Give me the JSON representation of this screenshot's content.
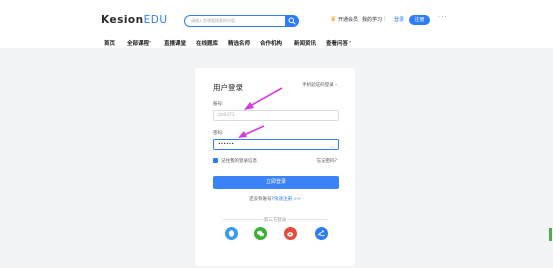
{
  "header": {
    "logo_main": "Kesion",
    "logo_accent": "EDU",
    "search_placeholder": "请输入您想要搜索的内容",
    "vip_label": "开通会员",
    "my_study": "我的学习",
    "separator": "|",
    "login": "登录",
    "register": "注册",
    "more": "···"
  },
  "nav": [
    "首页",
    "全部课程",
    "直播课堂",
    "在线题库",
    "精选名师",
    "合作机构",
    "新闻资讯",
    "查看问答"
  ],
  "login_card": {
    "title": "用户登录",
    "phone_login": "手机验证码登录 ›",
    "account_label": "账号:",
    "account_value": "zh9371",
    "password_label": "密码:",
    "password_value": "••••••",
    "remember": "记住我的登录信息",
    "forgot": "忘记密码?",
    "submit": "立即登录",
    "no_account": "还没有账号?",
    "register_link": "快速注册 >>",
    "third_party": "第三方登录"
  },
  "colors": {
    "accent": "#2f7df6",
    "arrow": "#d33be0"
  }
}
